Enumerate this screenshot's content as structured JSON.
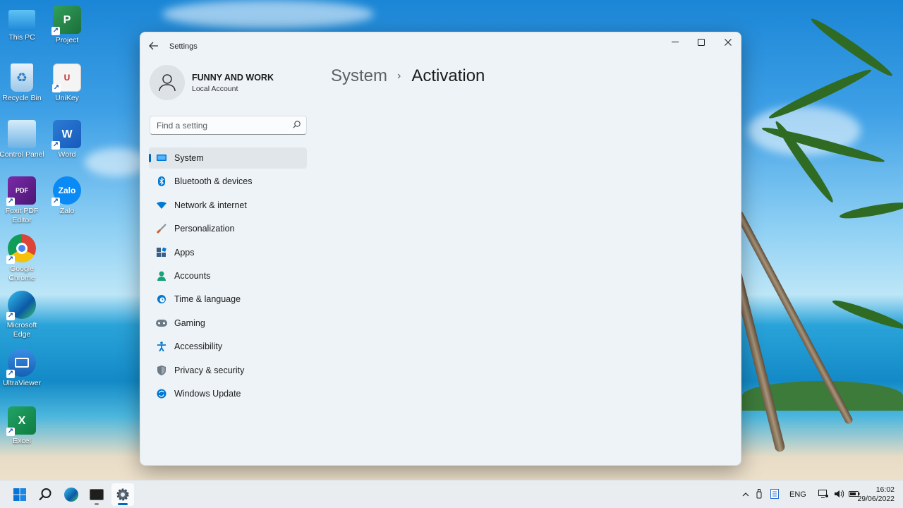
{
  "desktop": {
    "icons": [
      {
        "label": "This PC"
      },
      {
        "label": "Project"
      },
      {
        "label": "Recycle Bin"
      },
      {
        "label": "UniKey"
      },
      {
        "label": "Control Panel"
      },
      {
        "label": "Word"
      },
      {
        "label": "Foxit PDF Editor"
      },
      {
        "label": "Zalo"
      },
      {
        "label": "Google Chrome"
      },
      {
        "label": "Microsoft Edge"
      },
      {
        "label": "UltraViewer"
      },
      {
        "label": "Excel"
      }
    ],
    "icon_glyphs": {
      "project": "P",
      "word": "W",
      "excel": "X",
      "zalo": "Zalo",
      "pdf": "PDF"
    }
  },
  "window": {
    "title": "Settings",
    "controls": {
      "minimize": "—",
      "maximize": "☐",
      "close": "✕"
    },
    "profile": {
      "name": "FUNNY AND WORK",
      "type": "Local Account"
    },
    "search": {
      "placeholder": "Find a setting"
    },
    "nav": [
      {
        "label": "System",
        "icon": "monitor-icon",
        "color": "#0078d4",
        "active": true
      },
      {
        "label": "Bluetooth & devices",
        "icon": "bluetooth-icon",
        "color": "#0078d4"
      },
      {
        "label": "Network & internet",
        "icon": "wifi-icon",
        "color": "#0078d4"
      },
      {
        "label": "Personalization",
        "icon": "brush-icon",
        "color": "#c2652a"
      },
      {
        "label": "Apps",
        "icon": "apps-icon",
        "color": "#3b5f82"
      },
      {
        "label": "Accounts",
        "icon": "person-icon",
        "color": "#1aa37a"
      },
      {
        "label": "Time & language",
        "icon": "globe-clock-icon",
        "color": "#0078d4"
      },
      {
        "label": "Gaming",
        "icon": "gamepad-icon",
        "color": "#6c7a85"
      },
      {
        "label": "Accessibility",
        "icon": "accessibility-icon",
        "color": "#0078d4"
      },
      {
        "label": "Privacy & security",
        "icon": "shield-icon",
        "color": "#6c7a85"
      },
      {
        "label": "Windows Update",
        "icon": "update-icon",
        "color": "#0078d4"
      }
    ],
    "breadcrumb": {
      "parent": "System",
      "separator": "›",
      "current": "Activation"
    }
  },
  "taskbar": {
    "apps": [
      "start-icon",
      "search-icon",
      "edge-icon",
      "terminal-icon",
      "settings-icon"
    ],
    "tray": {
      "language": "ENG"
    },
    "clock": {
      "time": "16:02",
      "date": "29/06/2022"
    }
  },
  "colors": {
    "accent": "#0067c0"
  }
}
